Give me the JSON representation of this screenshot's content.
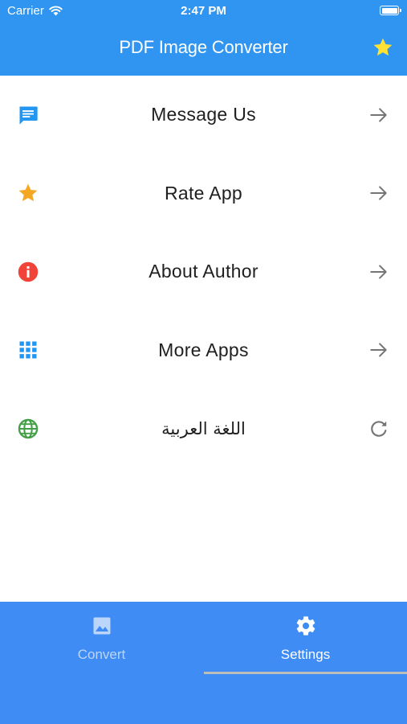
{
  "status_bar": {
    "carrier": "Carrier",
    "time": "2:47 PM"
  },
  "header": {
    "title": "PDF Image Converter",
    "favorite_icon": "star-icon",
    "color": "#2f95f0"
  },
  "settings": {
    "items": [
      {
        "label": "Message Us",
        "icon": "chat-bubble-icon",
        "icon_color": "#2196f3",
        "action": "arrow-right-icon"
      },
      {
        "label": "Rate App",
        "icon": "star-icon",
        "icon_color": "#f5a623",
        "action": "arrow-right-icon"
      },
      {
        "label": "About Author",
        "icon": "info-icon",
        "icon_color": "#f04438",
        "action": "arrow-right-icon"
      },
      {
        "label": "More Apps",
        "icon": "grid-icon",
        "icon_color": "#2196f3",
        "action": "arrow-right-icon"
      },
      {
        "label": "اللغة العربية",
        "icon": "globe-icon",
        "icon_color": "#43a047",
        "action": "refresh-icon"
      }
    ]
  },
  "bottom_nav": {
    "color": "#3f8cf5",
    "tabs": [
      {
        "label": "Convert",
        "icon": "image-icon",
        "active": false
      },
      {
        "label": "Settings",
        "icon": "gear-icon",
        "active": true
      }
    ]
  }
}
